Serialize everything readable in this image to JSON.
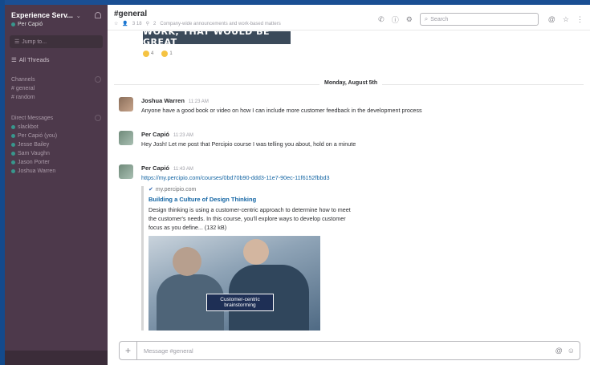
{
  "team": {
    "name": "Experience Serv...",
    "user": "Per Capió"
  },
  "sidebar": {
    "jump_label": "Jump to...",
    "threads_label": "All Threads",
    "channels_header": "Channels",
    "channels": [
      "# general",
      "# random"
    ],
    "dm_header": "Direct Messages",
    "dms": [
      {
        "name": "slackbot",
        "status": "online"
      },
      {
        "name": "Per Capió (you)",
        "status": "online"
      },
      {
        "name": "Jesse Bailey",
        "status": "online"
      },
      {
        "name": "Sam Vaughn",
        "status": "online"
      },
      {
        "name": "Jason Porter",
        "status": "online"
      },
      {
        "name": "Joshua Warren",
        "status": "online"
      }
    ]
  },
  "header": {
    "channel": "#general",
    "members": "3 18",
    "pins": "2",
    "topic": "Company-wide announcements and work-based matters",
    "search_placeholder": "Search"
  },
  "feed": {
    "meme_text": "WORK, THAT WOULD BE GREAT",
    "reactions": [
      {
        "count": "4"
      },
      {
        "count": "1"
      }
    ],
    "date_divider": "Monday, August 5th",
    "messages": [
      {
        "author": "Joshua Warren",
        "time": "11:23 AM",
        "text": "Anyone have a good book or video on how I can include more customer feedback in the development process"
      },
      {
        "author": "Per Capió",
        "time": "11:23 AM",
        "text": "Hey Josh! Let me post that Percipio course I was telling you about, hold on a minute"
      },
      {
        "author": "Per Capió",
        "time": "11:43 AM",
        "link": "https://my.percipio.com/courses/0bd70b90-ddd3-11e7-90ec-11f6152fbbd3",
        "attachment": {
          "site": "my.percipio.com",
          "title": "Building a Culture of Design Thinking",
          "desc_line1": "Design thinking is using a customer-centric approach to determine how to meet",
          "desc_line2": "the customer's needs. In this course, you'll explore ways to develop customer",
          "desc_line3": "focus as you define... (132 kB)",
          "caption_line1": "Customer-centric",
          "caption_line2": "brainstorming"
        }
      }
    ]
  },
  "composer": {
    "placeholder": "Message #general"
  }
}
